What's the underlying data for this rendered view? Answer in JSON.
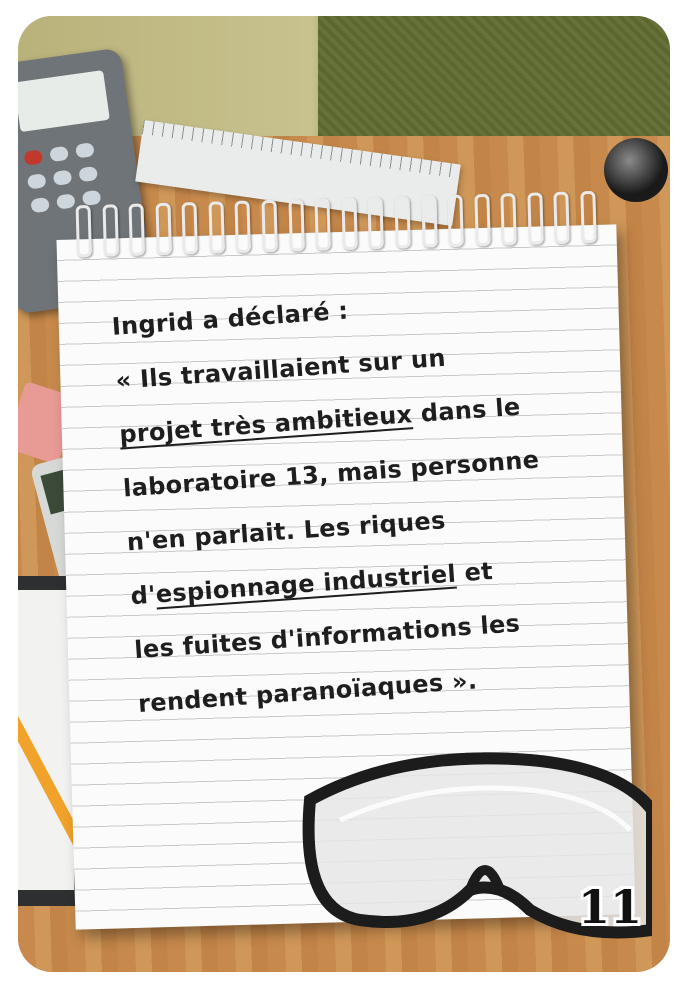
{
  "card": {
    "number": "11",
    "note": {
      "line1": "Ingrid a déclaré :",
      "line2": "« Ils travaillaient sur un",
      "line3a": "projet très ambitieux",
      "line3b": " dans le",
      "line4": "laboratoire 13, mais personne",
      "line5": "n'en parlait. Les riques",
      "line6a": "d'",
      "line6b": "espionnage industriel",
      "line6c": " et",
      "line7": "les fuites d'informations les",
      "line8": "rendent paranoïaques »."
    }
  },
  "colors": {
    "desk": "#c98d4f",
    "paper": "#fbfbfb",
    "ink": "#1e1e1e"
  },
  "icons": [
    "calculator-icon",
    "ruler-icon",
    "eraser-icon",
    "phone-icon",
    "tablet-icon",
    "pencil-icon",
    "safety-goggles-icon"
  ]
}
